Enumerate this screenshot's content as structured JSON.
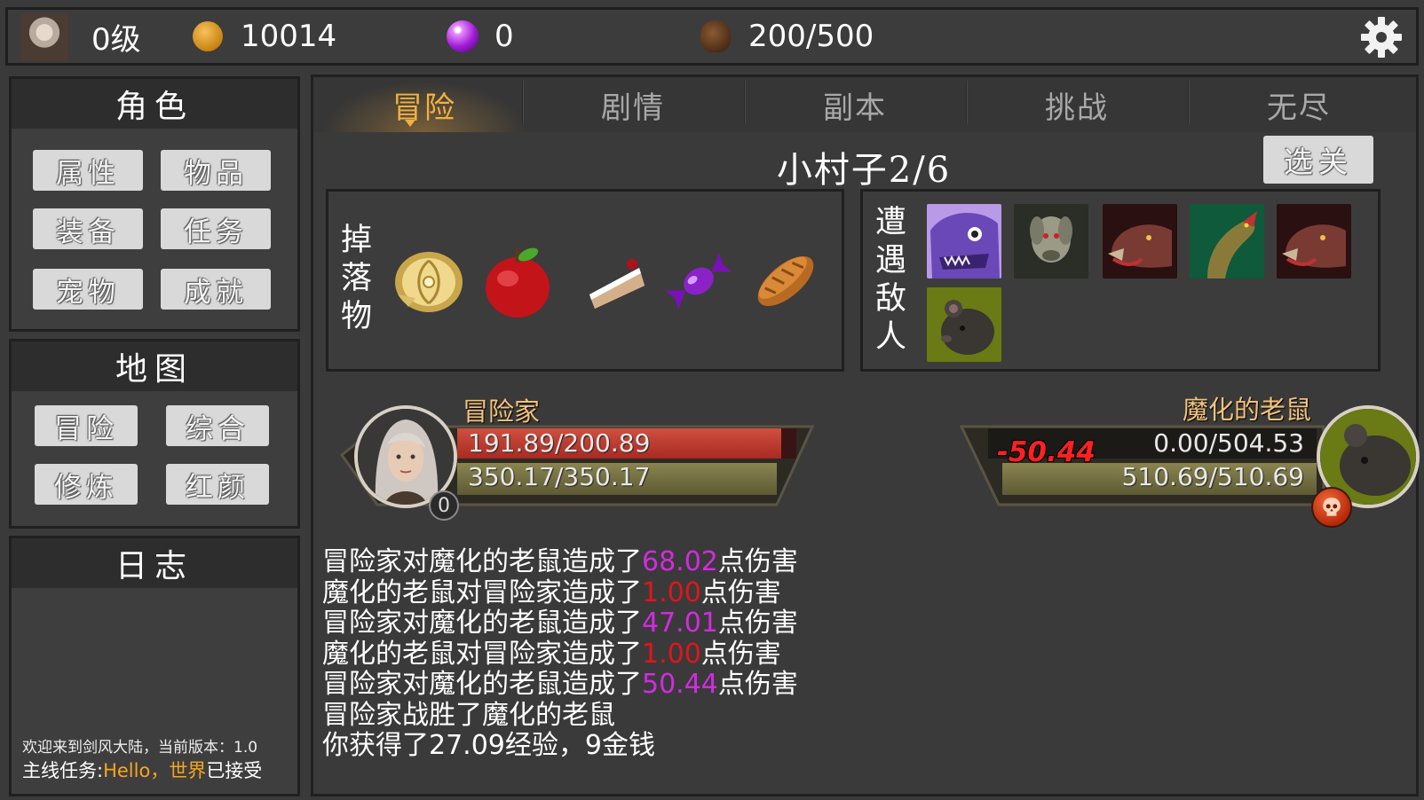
{
  "top": {
    "level": "0级",
    "gold": "10014",
    "gems": "0",
    "stamina": "200/500"
  },
  "left": {
    "role": {
      "title": "角色",
      "buttons": [
        "属性",
        "物品",
        "装备",
        "任务",
        "宠物",
        "成就"
      ]
    },
    "map": {
      "title": "地图",
      "buttons": [
        "冒险",
        "综合",
        "修炼",
        "红颜"
      ]
    },
    "log": {
      "title": "日志",
      "line1": "欢迎来到剑风大陆，当前版本：1.0",
      "line2_prefix": "主线任务:",
      "line2_highlight1": "Hello，",
      "line2_highlight2": "世界",
      "line2_suffix": "已接受"
    }
  },
  "tabs": [
    "冒险",
    "剧情",
    "副本",
    "挑战",
    "无尽"
  ],
  "active_tab": "冒险",
  "stage": {
    "title": "小村子2/6",
    "select_label": "选关"
  },
  "drops": {
    "label": [
      "掉",
      "落",
      "物"
    ],
    "items": [
      "fish-steak-icon",
      "apple-icon",
      "cake-slice-icon",
      "candy-icon",
      "bread-icon"
    ]
  },
  "enemies": {
    "label": [
      "遭",
      "遇",
      "敌",
      "人"
    ],
    "list": [
      "purple-beast-icon",
      "zombie-dog-icon",
      "boar-icon",
      "snake-icon",
      "boar-icon",
      "rat-icon"
    ]
  },
  "combat": {
    "player": {
      "name": "冒险家",
      "hp": "191.89/200.89",
      "hp_fraction": 0.955,
      "mp": "350.17/350.17",
      "level_badge": "0"
    },
    "enemy": {
      "name": "魔化的老鼠",
      "hp": "0.00/504.53",
      "hp_fraction": 0,
      "mp": "510.69/510.69",
      "damage": "-50.44"
    }
  },
  "battle_log": [
    {
      "pre": "冒险家对魔化的老鼠造成了",
      "num": "68.02",
      "post": "点伤害",
      "color": "mag"
    },
    {
      "pre": "魔化的老鼠对冒险家造成了",
      "num": "1.00",
      "post": "点伤害",
      "color": "red"
    },
    {
      "pre": "冒险家对魔化的老鼠造成了",
      "num": "47.01",
      "post": "点伤害",
      "color": "mag"
    },
    {
      "pre": "魔化的老鼠对冒险家造成了",
      "num": "1.00",
      "post": "点伤害",
      "color": "red"
    },
    {
      "pre": "冒险家对魔化的老鼠造成了",
      "num": "50.44",
      "post": "点伤害",
      "color": "mag"
    },
    {
      "pre": "冒险家战胜了魔化的老鼠",
      "num": "",
      "post": "",
      "color": ""
    },
    {
      "pre": "你获得了27.09经验，9金钱",
      "num": "",
      "post": "",
      "color": ""
    }
  ],
  "colors": {
    "damage_dealt": "#d22be0",
    "damage_taken": "#e3141a",
    "active_tab": "#f1b040",
    "quest_highlight": "#f7a520"
  }
}
